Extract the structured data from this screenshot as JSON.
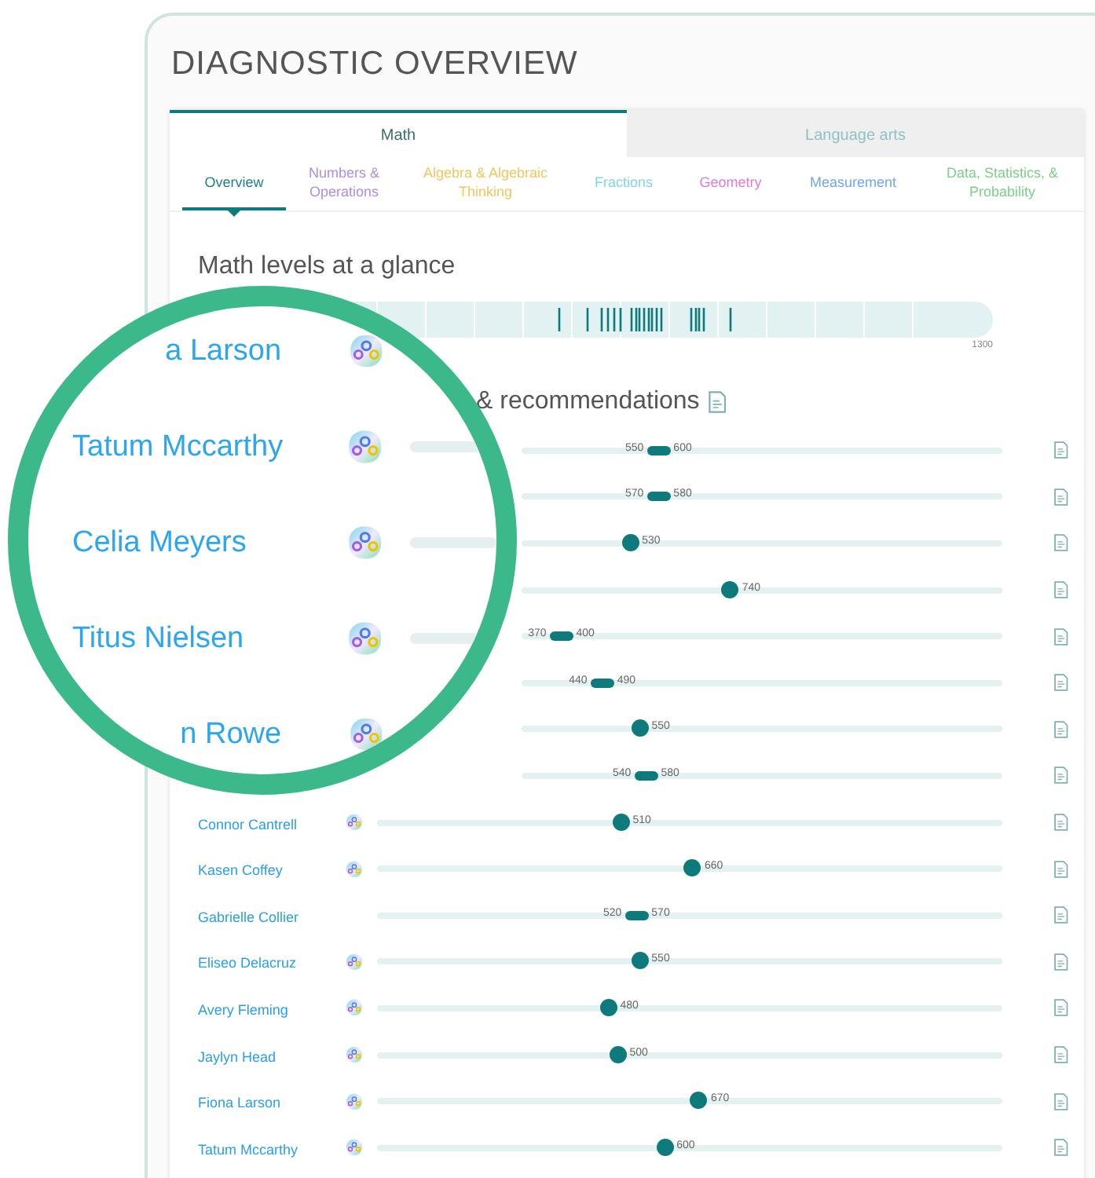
{
  "title": "DIAGNOSTIC OVERVIEW",
  "subjects": [
    {
      "label": "Math",
      "selected": true
    },
    {
      "label": "Language arts",
      "selected": false
    }
  ],
  "domains": [
    {
      "label": "Overview",
      "selected": true,
      "color": "#1d7f80"
    },
    {
      "label": "Numbers & Operations",
      "selected": false,
      "color": "#b08de0"
    },
    {
      "label": "Algebra & Algebraic Thinking",
      "selected": false,
      "color": "#efc75e"
    },
    {
      "label": "Fractions",
      "selected": false,
      "color": "#7fd6df"
    },
    {
      "label": "Geometry",
      "selected": false,
      "color": "#e07bd2"
    },
    {
      "label": "Measurement",
      "selected": false,
      "color": "#6fa6ee"
    },
    {
      "label": "Data, Statistics, & Probability",
      "selected": false,
      "color": "#7dcd8b"
    }
  ],
  "glance": {
    "heading": "Math levels at a glance",
    "max_label": "1300"
  },
  "recommendations": {
    "heading": "& recommendations"
  },
  "students": [
    {
      "kind": "range",
      "level": 0.286,
      "low": "550",
      "high": "600"
    },
    {
      "kind": "range",
      "level": 0.286,
      "low": "570",
      "high": "580"
    },
    {
      "kind": "point",
      "level": 0.227,
      "score": "530"
    },
    {
      "kind": "point",
      "level": 0.435,
      "score": "740"
    },
    {
      "kind": "range",
      "level": 0.084,
      "low": "370",
      "high": "400"
    },
    {
      "kind": "range",
      "level": 0.169,
      "low": "440",
      "high": "490"
    },
    {
      "kind": "point",
      "level": 0.247,
      "score": "550"
    },
    {
      "kind": "range",
      "level": 0.26,
      "low": "540",
      "high": "580"
    },
    {
      "kind": "point",
      "level": 0.39,
      "score": "510",
      "name": "Connor Cantrell",
      "badge": true
    },
    {
      "kind": "point",
      "level": 0.505,
      "score": "660",
      "name": "Kasen Coffey",
      "badge": true
    },
    {
      "kind": "range",
      "level": 0.415,
      "low": "520",
      "high": "570",
      "name": "Gabrielle Collier",
      "badge": false
    },
    {
      "kind": "point",
      "level": 0.42,
      "score": "550",
      "name": "Eliseo Delacruz",
      "badge": true
    },
    {
      "kind": "point",
      "level": 0.37,
      "score": "480",
      "name": "Avery Fleming",
      "badge": true
    },
    {
      "kind": "point",
      "level": 0.385,
      "score": "500",
      "name": "Jaylyn Head",
      "badge": true
    },
    {
      "kind": "point",
      "level": 0.515,
      "score": "670",
      "name": "Fiona Larson",
      "badge": true
    },
    {
      "kind": "point",
      "level": 0.46,
      "score": "600",
      "name": "Tatum Mccarthy",
      "badge": true
    }
  ],
  "magnifier": {
    "rows": [
      {
        "kind": "partial",
        "name": "a Larson",
        "badge": true
      },
      {
        "kind": "full",
        "name": "Tatum Mccarthy",
        "badge": true
      },
      {
        "kind": "full",
        "name": "Celia Meyers",
        "badge": true
      },
      {
        "kind": "full",
        "name": "Titus Nielsen",
        "badge": true
      },
      {
        "kind": "partial",
        "name": "n Rowe",
        "badge": true
      }
    ]
  }
}
